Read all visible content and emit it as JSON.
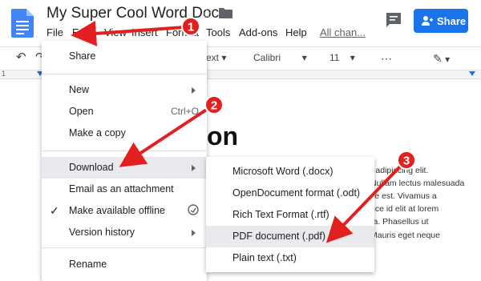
{
  "header": {
    "doc_title": "My Super Cool Word Doc",
    "share_label": "Share",
    "icons": {
      "app": "google-docs-icon",
      "star": "star-icon",
      "folder": "folder-icon",
      "comment": "comment-icon",
      "lock": "lock-icon"
    }
  },
  "menubar": {
    "file": "File",
    "edit": "Edit",
    "view": "View",
    "insert": "Insert",
    "format": "Format",
    "tools": "Tools",
    "addons": "Add-ons",
    "help": "Help",
    "last_edit": "All chan..."
  },
  "toolbar": {
    "undo": "↶",
    "redo": "↷",
    "style_select": "ext",
    "font_select": "Calibri",
    "size_select": "11",
    "more": "⋯",
    "pencil": "✎"
  },
  "ruler": {
    "left_tick": "1"
  },
  "document": {
    "heading": "on",
    "lines": [
      "r adipiscing elit.",
      "Nullam lectus malesuada",
      "se est. Vivamus a",
      "nce id elit at lorem",
      "ra. Phasellus ut",
      "Mauris eget neque"
    ]
  },
  "file_menu": {
    "share": "Share",
    "new": "New",
    "open": "Open",
    "open_shortcut": "Ctrl+O",
    "make_copy": "Make a copy",
    "download": "Download",
    "email": "Email as an attachment",
    "offline": "Make available offline",
    "history": "Version history",
    "rename": "Rename"
  },
  "download_submenu": [
    "Microsoft Word (.docx)",
    "OpenDocument format (.odt)",
    "Rich Text Format (.rtf)",
    "PDF document (.pdf)",
    "Plain text (.txt)"
  ],
  "annotations": {
    "steps": [
      "1",
      "2",
      "3"
    ],
    "arrow_color": "#e32020"
  },
  "colors": {
    "accent": "#1a73e8",
    "highlight": "#e8eaed"
  }
}
